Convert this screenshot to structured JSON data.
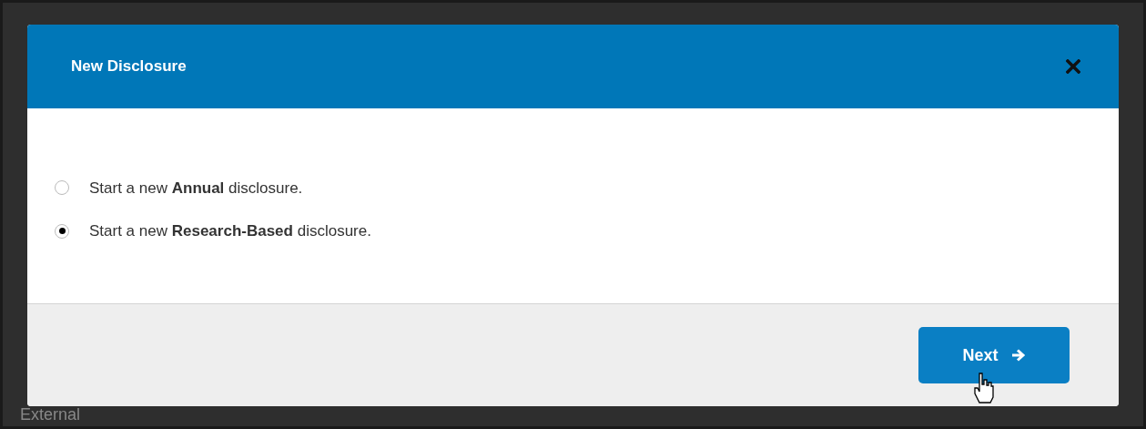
{
  "background": {
    "row_label": "External"
  },
  "dialog": {
    "title": "New Disclosure",
    "options": [
      {
        "label": "Start a new **Annual** disclosure.",
        "selected": false
      },
      {
        "label": "Start a new **Research-Based** disclosure.",
        "selected": true
      }
    ],
    "buttons": [
      {
        "label": "Next"
      }
    ]
  }
}
